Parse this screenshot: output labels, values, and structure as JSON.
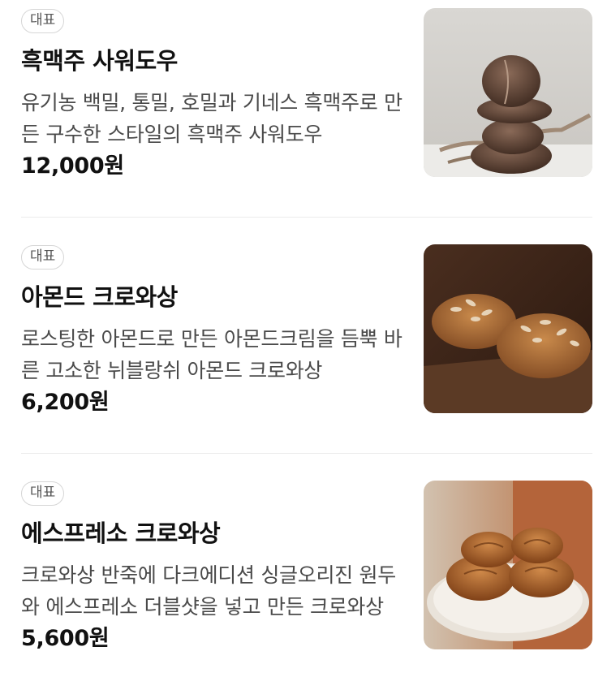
{
  "menu": {
    "items": [
      {
        "badge": "대표",
        "name": "흑맥주 사워도우",
        "description": "유기농 백밀, 통밀, 호밀과 기네스 흑맥주로 만든 구수한 스타일의 흑맥주 사워도우",
        "price": "12,000원",
        "image": "stacked-sourdough-photo"
      },
      {
        "badge": "대표",
        "name": "아몬드 크로와상",
        "description": "로스팅한 아몬드로 만든 아몬드크림을 듬뿍 바른 고소한 뉘블랑쉬 아몬드 크로와상",
        "price": "6,200원",
        "image": "almond-croissant-photo"
      },
      {
        "badge": "대표",
        "name": "에스프레소 크로와상",
        "description": "크로와상 반죽에 다크에디션 싱글오리진 원두와 에스프레소 더블샷을 넣고 만든 크로와상",
        "price": "5,600원",
        "image": "espresso-croissant-photo"
      }
    ]
  }
}
